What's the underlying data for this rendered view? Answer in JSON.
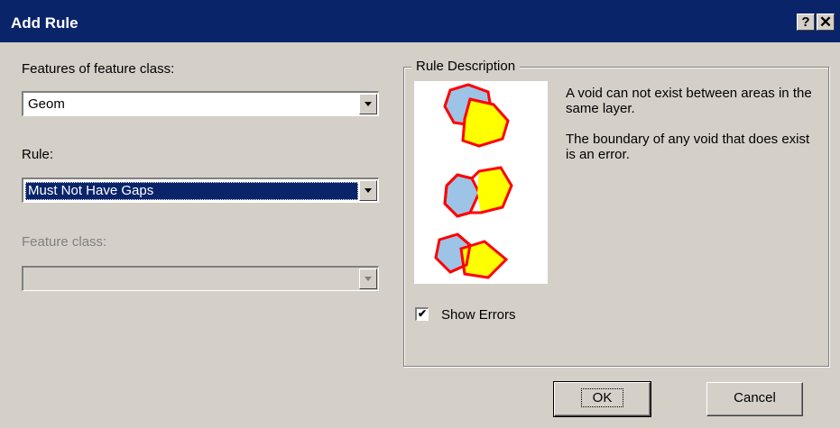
{
  "window": {
    "title": "Add Rule",
    "help_label": "?",
    "close_label": "✕"
  },
  "form": {
    "features_label": "Features of feature class:",
    "features_value": "Geom",
    "rule_label": "Rule:",
    "rule_value": "Must Not Have Gaps",
    "feature_class_label": "Feature class:",
    "feature_class_value": ""
  },
  "rule_description": {
    "legend": "Rule Description",
    "paragraphs": [
      "A void can not exist between areas in the same layer.",
      "The boundary of any void that does exist is an error."
    ],
    "show_errors_label": "Show Errors",
    "show_errors_checked": true
  },
  "buttons": {
    "ok": "OK",
    "cancel": "Cancel"
  },
  "colors": {
    "titlebar": "#0a246a",
    "face": "#d4d0c8",
    "polygon_blue": "#9dc3e6",
    "polygon_yellow": "#ffff00",
    "error_red": "#ff0000"
  }
}
